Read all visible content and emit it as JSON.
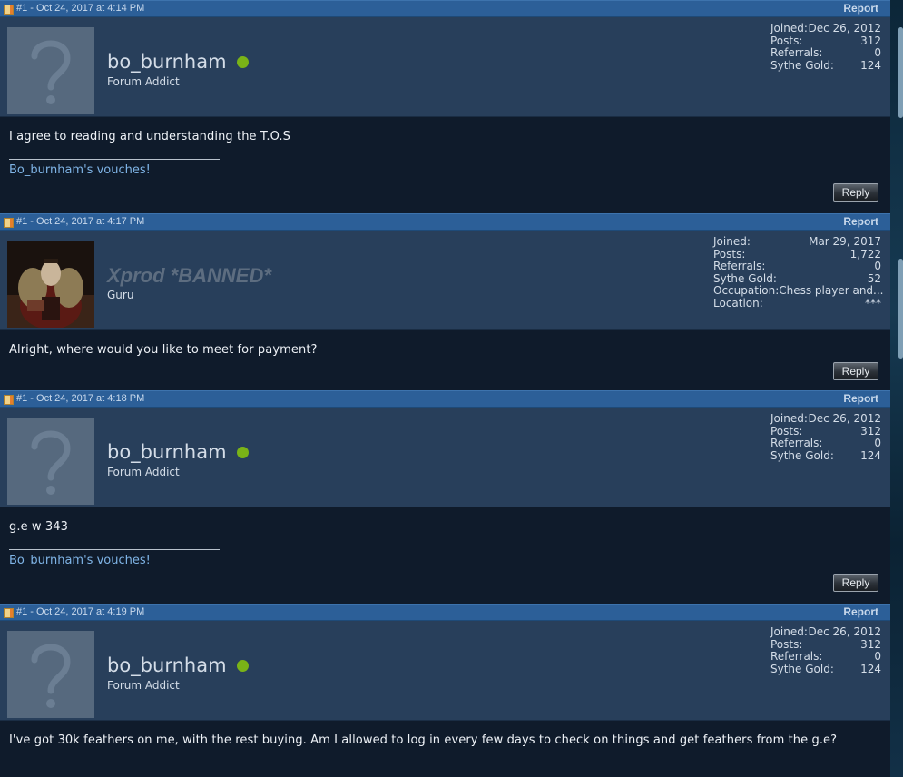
{
  "posts": [
    {
      "header": {
        "date": "#1 - Oct 24, 2017 at 4:14 PM",
        "report": "Report"
      },
      "user": {
        "name": "bo_burnham",
        "title": "Forum Addict",
        "online": true,
        "banned": false,
        "avatar": "default-avatar"
      },
      "stats": [
        {
          "label": "Joined:",
          "value": "Dec 26, 2012"
        },
        {
          "label": "Posts:",
          "value": "312"
        },
        {
          "label": "Referrals:",
          "value": "0"
        },
        {
          "label": "Sythe Gold:",
          "value": "124"
        }
      ],
      "body": {
        "text": "I agree to reading and understanding the T.O.S",
        "signature": "Bo_burnham's vouches!"
      },
      "reply": "Reply"
    },
    {
      "header": {
        "date": "#1 - Oct 24, 2017 at 4:17 PM",
        "report": "Report"
      },
      "user": {
        "name": "Xprod *BANNED*",
        "title": "Guru",
        "online": false,
        "banned": true,
        "avatar": "character-avatar"
      },
      "stats": [
        {
          "label": "Joined:",
          "value": "Mar 29, 2017"
        },
        {
          "label": "Posts:",
          "value": "1,722"
        },
        {
          "label": "Referrals:",
          "value": "0"
        },
        {
          "label": "Sythe Gold:",
          "value": "52"
        },
        {
          "label": "Occupation:",
          "value": "Chess player and..."
        },
        {
          "label": "Location:",
          "value": "***"
        }
      ],
      "body": {
        "text": "Alright, where would you like to meet for payment?",
        "signature": ""
      },
      "reply": "Reply"
    },
    {
      "header": {
        "date": "#1 - Oct 24, 2017 at 4:18 PM",
        "report": "Report"
      },
      "user": {
        "name": "bo_burnham",
        "title": "Forum Addict",
        "online": true,
        "banned": false,
        "avatar": "default-avatar"
      },
      "stats": [
        {
          "label": "Joined:",
          "value": "Dec 26, 2012"
        },
        {
          "label": "Posts:",
          "value": "312"
        },
        {
          "label": "Referrals:",
          "value": "0"
        },
        {
          "label": "Sythe Gold:",
          "value": "124"
        }
      ],
      "body": {
        "text": "g.e w 343",
        "signature": "Bo_burnham's vouches!"
      },
      "reply": "Reply"
    },
    {
      "header": {
        "date": "#1 - Oct 24, 2017 at 4:19 PM",
        "report": "Report"
      },
      "user": {
        "name": "bo_burnham",
        "title": "Forum Addict",
        "online": true,
        "banned": false,
        "avatar": "default-avatar"
      },
      "stats": [
        {
          "label": "Joined:",
          "value": "Dec 26, 2012"
        },
        {
          "label": "Posts:",
          "value": "312"
        },
        {
          "label": "Referrals:",
          "value": "0"
        },
        {
          "label": "Sythe Gold:",
          "value": "124"
        }
      ],
      "body": {
        "text": "I've got 30k feathers on me, with the rest buying. Am I allowed to log in every few days to check on things and get feathers from the g.e?",
        "signature": ""
      },
      "reply": ""
    }
  ],
  "colors": {
    "header_bar": "#2c5f98",
    "userinfo_bg": "#283f5b",
    "body_bg": "#0f1b2b",
    "online_dot": "#7ab317",
    "signature_link": "#7fb4e6"
  }
}
